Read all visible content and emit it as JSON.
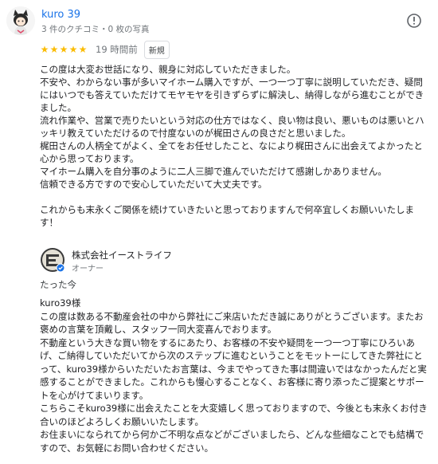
{
  "review": {
    "author": "kuro 39",
    "meta": "3 件のクチコミ・0 枚の写真",
    "rating_value": 5,
    "rating_max": 5,
    "time": "19 時間前",
    "badge": "新規",
    "body": "この度は大変お世話になり、親身に対応していただきました。\n不安や、わからない事が多いマイホーム購入ですが、一つ一つ丁寧に説明していただき、疑問にはいつでも答えていただけてモヤモヤを引きずらずに解決し、納得しながら進むことができました。\n流れ作業や、営業で売りたいという対応の仕方ではなく、良い物は良い、悪いものは悪いとハッキリ教えていただけるので忖度ないのが梶田さんの良さだと思いました。\n梶田さんの人柄全てがよく、全てをお任せしたこと、なにより梶田さんに出会えてよかったと心から思っております。\nマイホーム購入を自分事のように二人三脚で進んでいただけて感謝しかありません。\n信頼できる方ですので安心していただいて大丈夫です。\n\nこれからも末永くご関係を続けていきたいと思っておりますんで何卒宜しくお願いいたします！",
    "icons": {
      "avatar": "cat-avatar-icon",
      "more": "info-icon",
      "star": "star-icon"
    },
    "colors": {
      "star": "#fbbc04",
      "link": "#1a73e8"
    }
  },
  "owner": {
    "name": "株式会社イーストライフ",
    "role": "オーナー",
    "time": "たった今",
    "reply": "kuro39様\nこの度は数ある不動産会社の中から弊社にご来店いただき誠にありがとうございます。またお褒めの言葉を頂戴し、スタッフ一同大変喜んでおります。\n不動産という大きな買い物をするにあたり、お客様の不安や疑問を一つ一つ丁寧にひろいあげ、ご納得していただいてから次のステップに進むということをモットーにしてきた弊社にとって、kuro39様からいただいたお言葉は、今までやってきた事は間違いではなかったんだと実感することができました。これからも慢心することなく、お客様に寄り添ったご提案とサポートを心がけてまいります。\nこちらこそkuro39様に出会えたことを大変嬉しく思っておりますので、今後とも末永くお付き合いのほどよろしくお願いいたします。\nお住まいになられてから何かご不明な点などがございましたら、どんな些細なことでも結構ですので、お気軽にお問い合わせください。",
    "icons": {
      "logo": "company-logo-icon",
      "verified": "verified-check-icon"
    },
    "colors": {
      "verified": "#1a73e8",
      "logo_bg": "#3a3a3a"
    }
  }
}
